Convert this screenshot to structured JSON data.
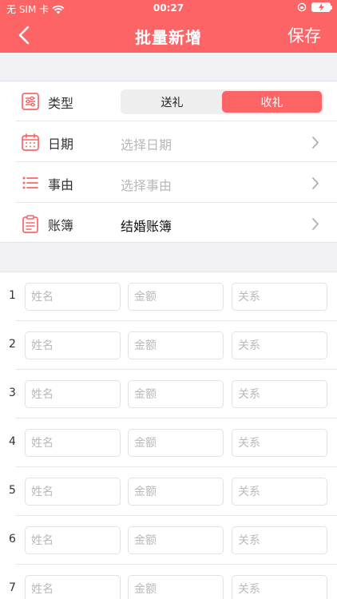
{
  "status": {
    "carrier": "无 SIM 卡",
    "time": "00:27"
  },
  "nav": {
    "title": "批量新增",
    "save_label": "保存"
  },
  "form": {
    "type": {
      "label": "类型",
      "options": [
        "送礼",
        "收礼"
      ],
      "selected": "收礼"
    },
    "date": {
      "label": "日期",
      "value": "选择日期"
    },
    "reason": {
      "label": "事由",
      "value": "选择事由"
    },
    "ledger": {
      "label": "账簿",
      "value": "结婚账簿"
    }
  },
  "entries": {
    "placeholders": {
      "name": "姓名",
      "amount": "金额",
      "relation": "关系"
    },
    "rows": [
      "1",
      "2",
      "3",
      "4",
      "5",
      "6",
      "7"
    ]
  },
  "colors": {
    "accent": "#fd6466"
  }
}
